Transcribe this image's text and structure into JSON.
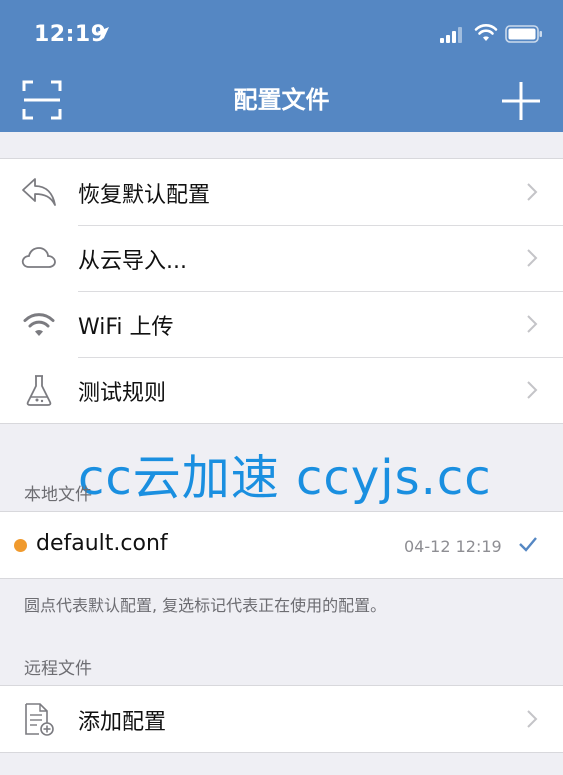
{
  "status": {
    "time": "12:19"
  },
  "nav": {
    "title": "配置文件"
  },
  "menu": [
    {
      "label": "恢复默认配置",
      "icon": "reply-arrow-icon"
    },
    {
      "label": "从云导入...",
      "icon": "cloud-icon"
    },
    {
      "label": "WiFi 上传",
      "icon": "wifi-icon"
    },
    {
      "label": "测试规则",
      "icon": "flask-icon"
    }
  ],
  "watermark": "cc云加速 ccyjs.cc",
  "local": {
    "header": "本地文件",
    "file": {
      "name": "default.conf",
      "date": "04-12 12:19"
    },
    "note": "圆点代表默认配置, 复选标记代表正在使用的配置。"
  },
  "remote": {
    "header": "远程文件",
    "add_label": "添加配置"
  },
  "colors": {
    "accent": "#5587c3",
    "dot": "#f09a2e",
    "check": "#5587c3",
    "watermark": "#1a8fe0"
  }
}
